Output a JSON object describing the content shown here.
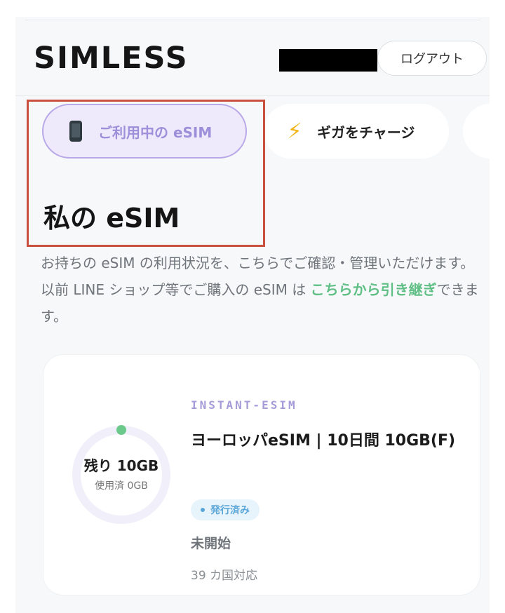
{
  "header": {
    "logo_text": "SIMLESS",
    "logout_label": "ログアウト"
  },
  "tabs": [
    {
      "label": "ご利用中の eSIM",
      "icon": "mobile-phone-icon",
      "active": true
    },
    {
      "label": "ギガをチャージ",
      "icon": "lightning-bolt-icon",
      "active": false
    }
  ],
  "page": {
    "title": "私の eSIM",
    "description_before_link": "お持ちの eSIM の利用状況を、こちらでご確認・管理いただけます。 以前 LINE ショップ等でご購入の eSIM は ",
    "description_link": "こちらから引き継ぎ",
    "description_after_link": "できます。"
  },
  "esim_card": {
    "remaining_label": "残り 10GB",
    "used_label": "使用済 0GB",
    "usage_fraction": 0,
    "product_type": "INSTANT-ESIM",
    "product_name": "ヨーロッパeSIM | 10日間 10GB(F)",
    "status_badge": "発行済み",
    "start_status": "未開始",
    "countries": "39 カ国対応"
  },
  "colors": {
    "accent_purple": "#9d8fd9",
    "link_green": "#5fbf85",
    "gauge_dot": "#6cc98c",
    "badge_blue": "#5aa6d8",
    "highlight_red": "#c9503f"
  }
}
